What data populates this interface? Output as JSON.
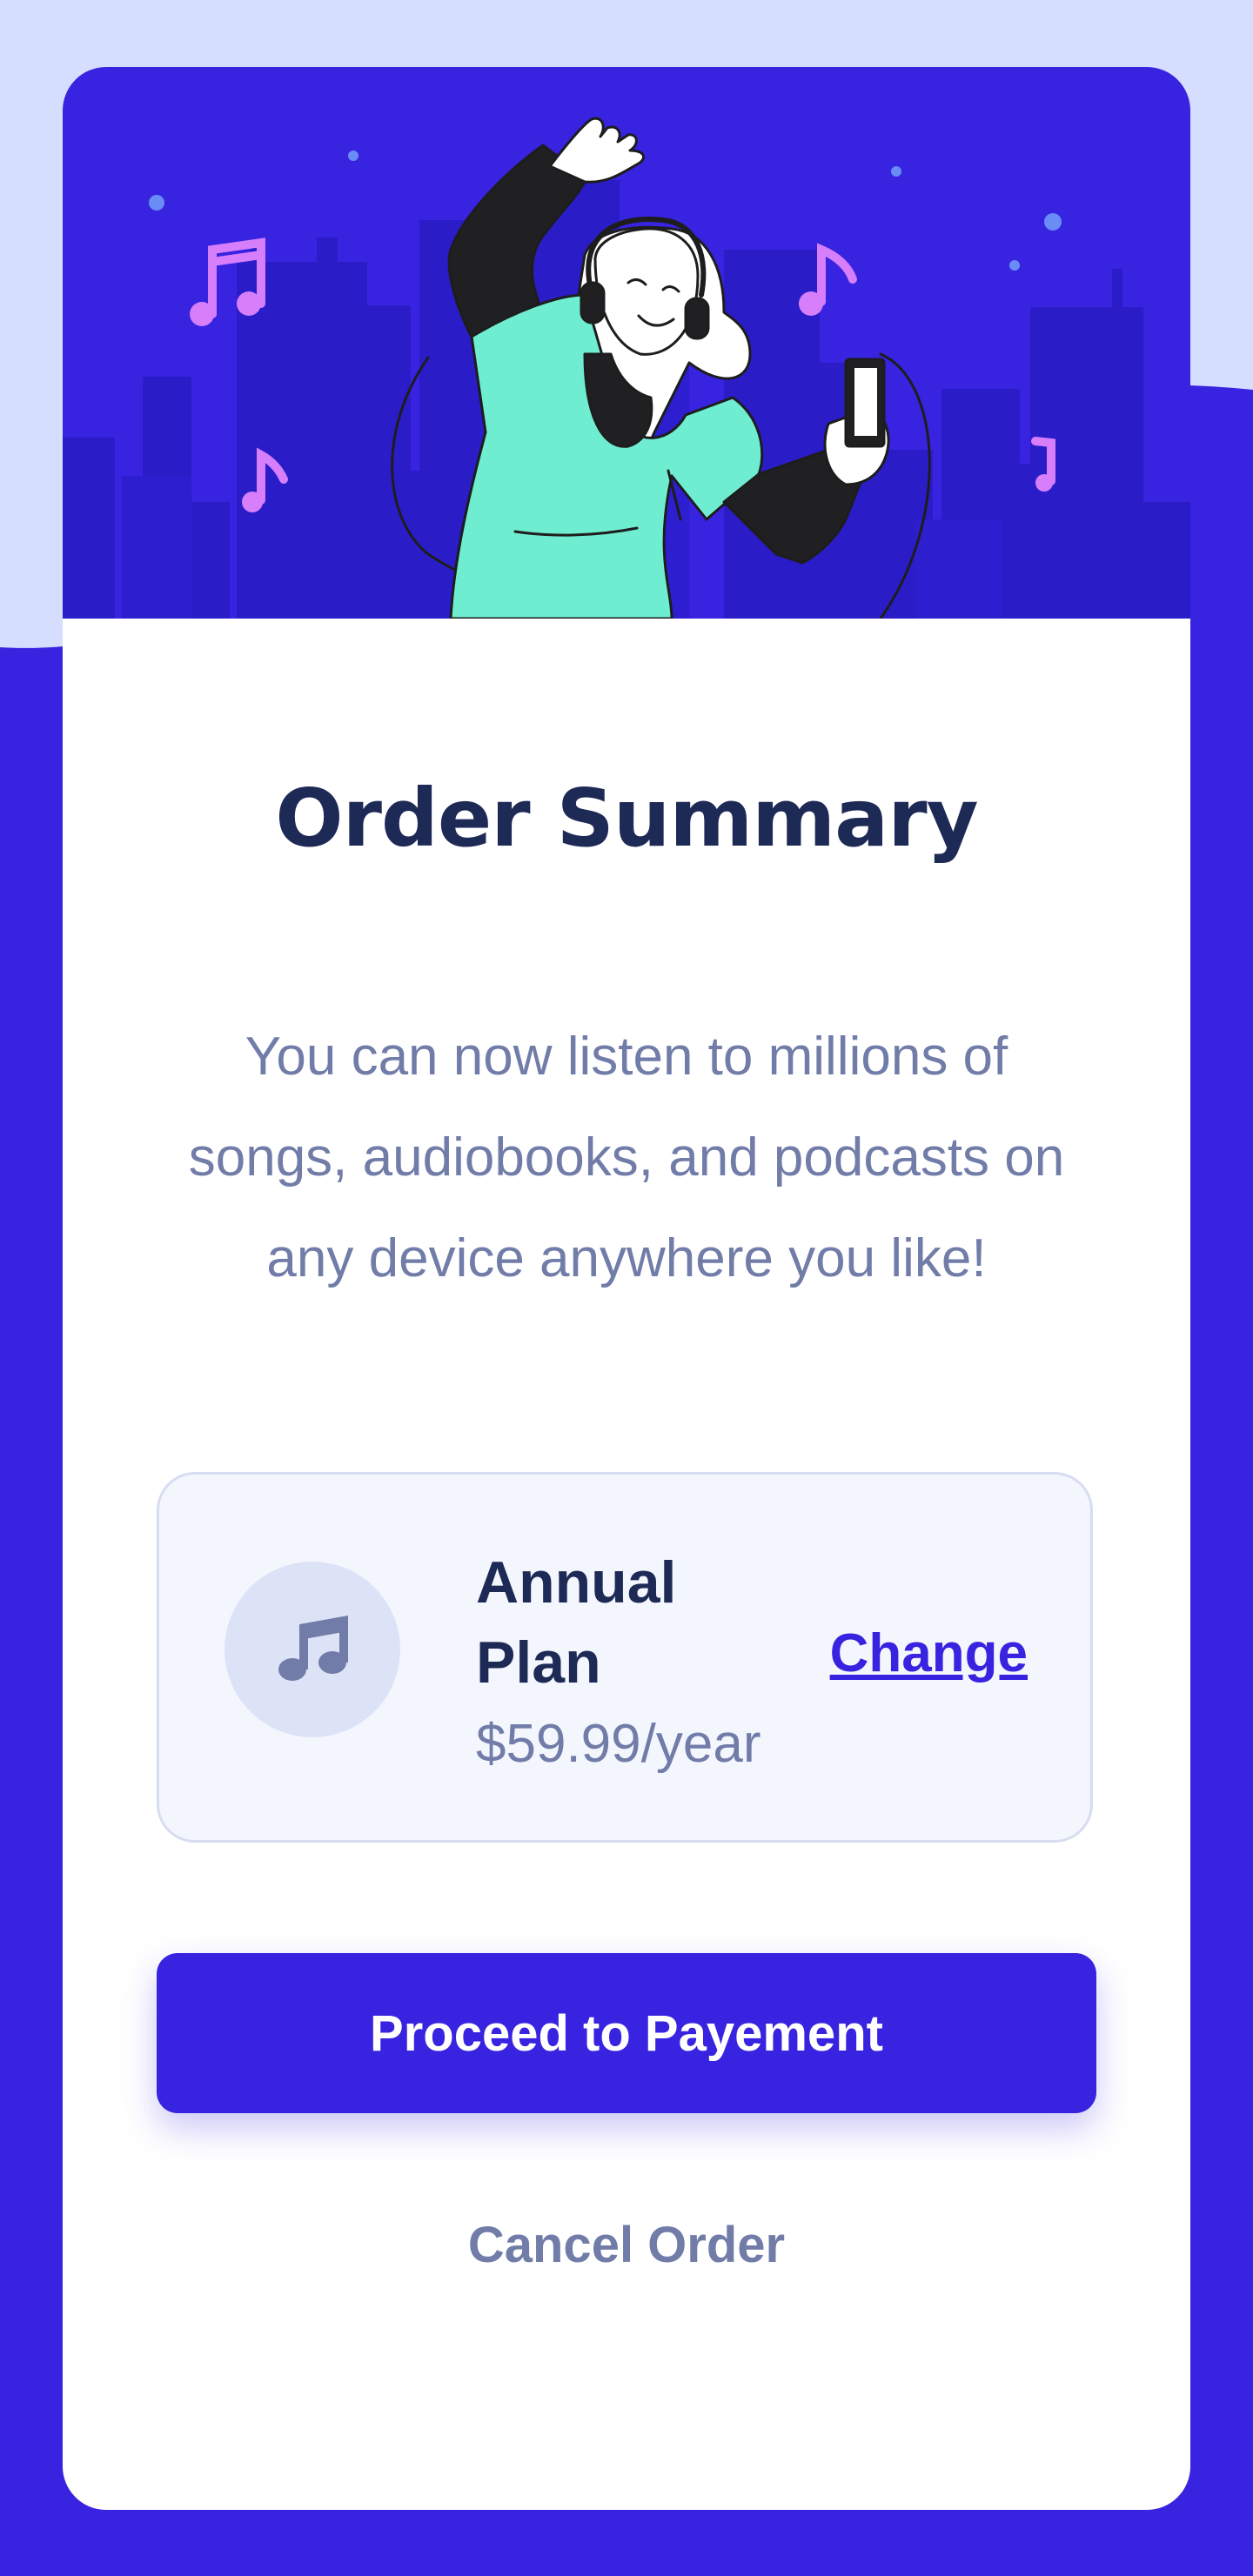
{
  "card": {
    "title": "Order Summary",
    "description": "You can now listen to millions of songs, audiobooks, and podcasts on any device anywhere you like!"
  },
  "plan": {
    "icon": "music-note-icon",
    "name": "Annual Plan",
    "price": "$59.99/year",
    "change_label": "Change"
  },
  "actions": {
    "proceed_label": "Proceed to Payement",
    "cancel_label": "Cancel Order"
  },
  "colors": {
    "page_background": "#3823e0",
    "pattern_light": "#d5defe",
    "accent": "#3823e0",
    "title": "#1e2a56",
    "muted_text": "#717da8",
    "plan_panel": "#f4f6fe",
    "hero_character_shirt": "#6fedd1",
    "music_notes": "#d77efb"
  }
}
